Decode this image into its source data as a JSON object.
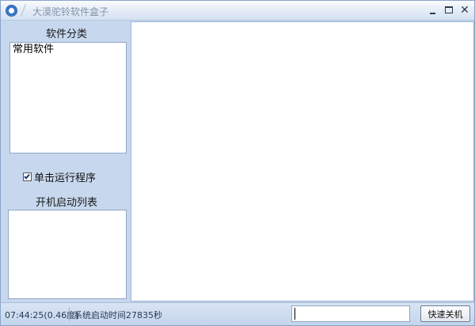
{
  "window": {
    "title": "大漠驼铃软件盒子"
  },
  "sidebar": {
    "category_title": "软件分类",
    "categories": [
      "常用软件"
    ],
    "single_click_label": "单击运行程序",
    "single_click_checked": true,
    "startup_title": "开机启动列表"
  },
  "statusbar": {
    "time": "07:44:25(0.46度)",
    "uptime": "系统启动时间27835秒",
    "quick_input_value": "",
    "shutdown_label": "快速关机"
  },
  "colors": {
    "panel_bg": "#c7d8ee",
    "border": "#8fa6c4"
  },
  "icons": [
    "app-icon",
    "minimize-icon",
    "maximize-icon",
    "close-icon",
    "checkbox-tick-icon"
  ]
}
